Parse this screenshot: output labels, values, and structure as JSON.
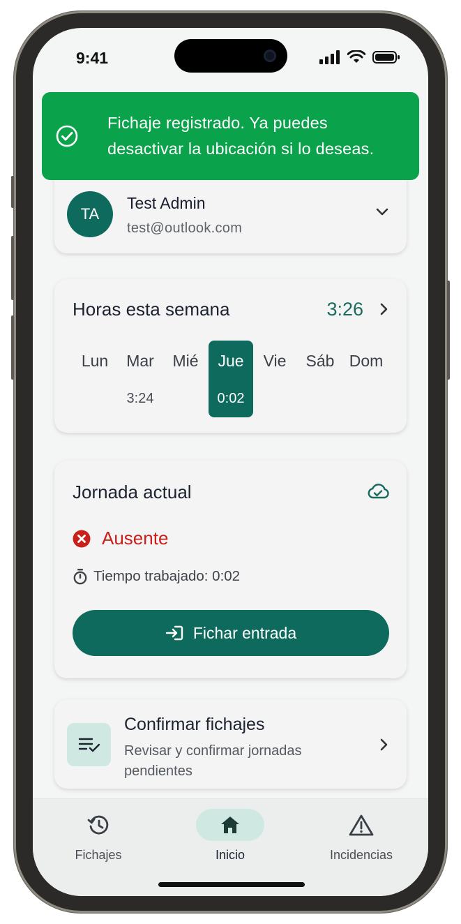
{
  "status_bar": {
    "time": "9:41"
  },
  "toast": {
    "message_line1": "Fichaje registrado. Ya puedes",
    "message_line2": "desactivar la ubicación si lo deseas."
  },
  "user": {
    "initials": "TA",
    "name": "Test Admin",
    "email": "test@outlook.com"
  },
  "hours": {
    "title": "Horas esta semana",
    "total": "3:26",
    "days": [
      {
        "label": "Lun",
        "value": ""
      },
      {
        "label": "Mar",
        "value": "3:24"
      },
      {
        "label": "Mié",
        "value": ""
      },
      {
        "label": "Jue",
        "value": "0:02",
        "active": true
      },
      {
        "label": "Vie",
        "value": ""
      },
      {
        "label": "Sáb",
        "value": ""
      },
      {
        "label": "Dom",
        "value": ""
      }
    ]
  },
  "shift": {
    "title": "Jornada actual",
    "status": "Ausente",
    "worked": "Tiempo trabajado: 0:02",
    "button_label": "Fichar entrada"
  },
  "confirm": {
    "title": "Confirmar fichajes",
    "subtitle": "Revisar y confirmar jornadas pendientes"
  },
  "nav": {
    "items": [
      {
        "label": "Fichajes",
        "icon": "history-icon"
      },
      {
        "label": "Inicio",
        "icon": "home-icon",
        "active": true
      },
      {
        "label": "Incidencias",
        "icon": "warning-icon"
      }
    ]
  },
  "colors": {
    "primary": "#0d6a5d",
    "success": "#0aa24a",
    "danger": "#c8201b",
    "accent_soft": "#cfe9e2"
  }
}
